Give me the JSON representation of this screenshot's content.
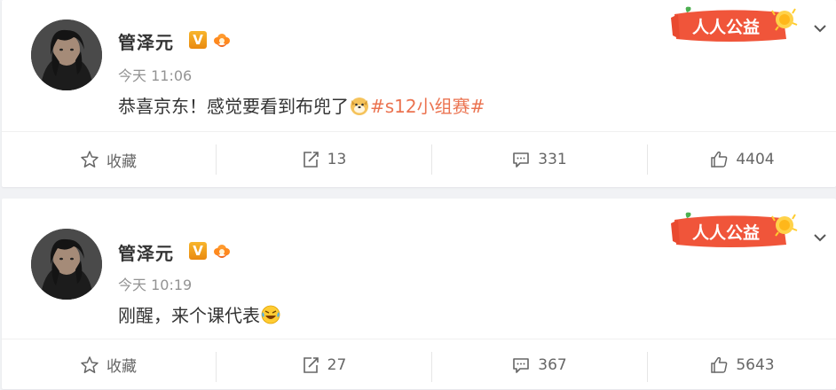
{
  "posts": [
    {
      "username": "管泽元",
      "v_badge": "V",
      "time": "今天 11:06",
      "text_before": "恭喜京东！感觉要看到布兜了",
      "emoji": "doge-icon",
      "topic": "#s12小组赛#",
      "badge_text": "人人公益",
      "actions": {
        "favorite": "收藏",
        "repost": "13",
        "comment": "331",
        "like": "4404"
      }
    },
    {
      "username": "管泽元",
      "v_badge": "V",
      "time": "今天 10:19",
      "text_before": "刚醒，来个课代表",
      "emoji": "laugh-cry-icon",
      "topic": "",
      "badge_text": "人人公益",
      "actions": {
        "favorite": "收藏",
        "repost": "27",
        "comment": "367",
        "like": "5643"
      }
    }
  ],
  "colors": {
    "topic": "#eb7350",
    "accent": "#ff8200",
    "muted": "#939393"
  }
}
